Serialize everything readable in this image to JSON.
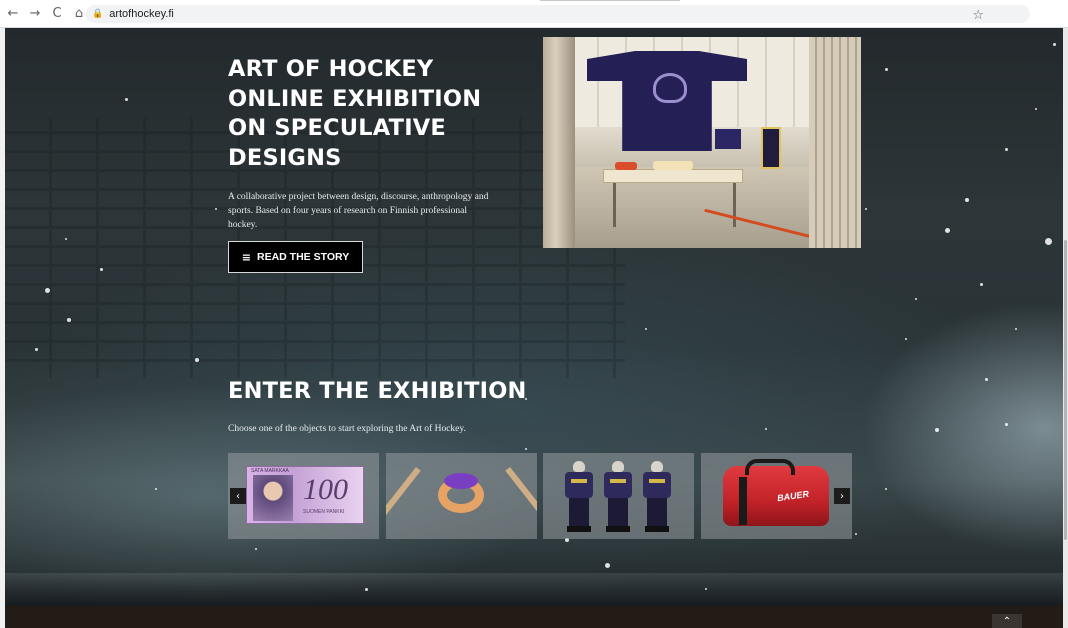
{
  "browser": {
    "back_glyph": "←",
    "forward_glyph": "→",
    "reload_glyph": "C",
    "home_glyph": "⌂",
    "lock_glyph": "🔒",
    "url": "artofhockey.fi",
    "star_glyph": "☆"
  },
  "hero": {
    "title_lines": [
      "ART OF HOCKEY",
      "ONLINE EXHIBITION",
      "ON SPECULATIVE",
      "DESIGNS"
    ],
    "description": "A collaborative project between design, discourse, anthropology and sports. Based on four years of research on Finnish professional hockey.",
    "button_glyph": "≡",
    "button_label": "READ THE STORY"
  },
  "exhibition": {
    "title": "ENTER THE EXHIBITION",
    "subtitle": "Choose one of the objects to start exploring the Art of Hockey.",
    "prev_glyph": "‹",
    "next_glyph": "›",
    "objects": [
      {
        "name": "banknote",
        "top_text": "SATA MARKKAA",
        "numeral": "100",
        "small_text": "SUOMEN PANKKI"
      },
      {
        "name": "puck-sticks"
      },
      {
        "name": "players"
      },
      {
        "name": "hockey-bag",
        "logo": "BAUER"
      }
    ]
  },
  "footer": {
    "scroll_top_glyph": "⌃"
  },
  "colors": {
    "button_bg": "#000000",
    "footer_bg": "#231b15",
    "bag_red": "#c12228",
    "bill_purple": "#c4a1d6"
  }
}
